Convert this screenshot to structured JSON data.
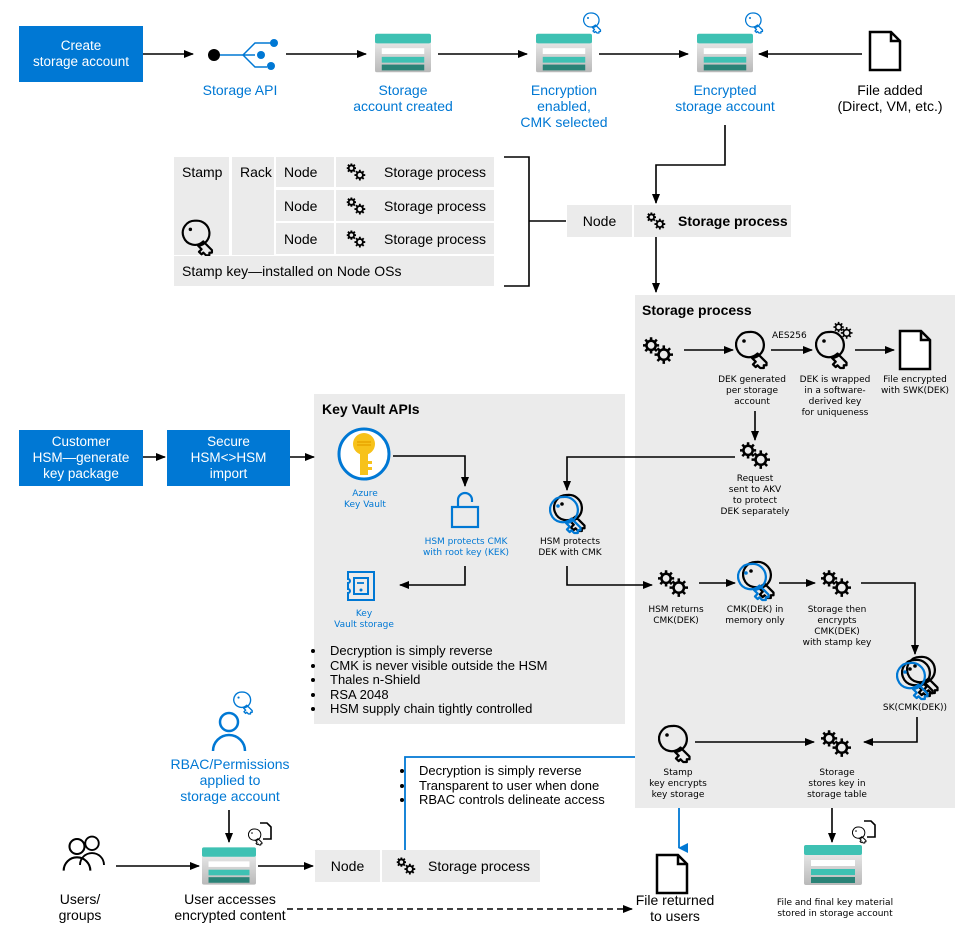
{
  "top_row": {
    "create_button": "Create\nstorage account",
    "storage_api": "Storage API",
    "account_created": "Storage\naccount created",
    "encryption_enabled": "Encryption\nenabled,\nCMK selected",
    "encrypted_account": "Encrypted\nstorage account",
    "file_added": "File added\n(Direct, VM, etc.)"
  },
  "stamp_table": {
    "stamp": "Stamp",
    "rack": "Rack",
    "rows": [
      {
        "node": "Node",
        "process": "Storage process"
      },
      {
        "node": "Node",
        "process": "Storage process"
      },
      {
        "node": "Node",
        "process": "Storage process"
      }
    ],
    "footer": "Stamp key—installed on Node OSs"
  },
  "node_bar": {
    "node": "Node",
    "process": "Storage process"
  },
  "storage_process_panel": {
    "title": "Storage process",
    "aes_label": "AES256",
    "dek_generated": "DEK generated\nper storage\naccount",
    "dek_wrapped": "DEK is wrapped\nin a software-\nderived key\nfor uniqueness",
    "file_encrypted": "File encrypted\nwith SWK(DEK)",
    "request_sent": "Request\nsent to AKV\nto protect\nDEK separately",
    "hsm_returns": "HSM returns\nCMK(DEK)",
    "cmk_in_memory": "CMK(DEK) in\nmemory only",
    "storage_encrypts": "Storage then\nencrypts\nCMK(DEK)\nwith stamp key",
    "sk_cmk_dek": "SK(CMK(DEK))",
    "stamp_key_encrypts": "Stamp\nkey encrypts\nkey storage",
    "storage_stores": "Storage\nstores key in\nstorage table"
  },
  "hsm_flow": {
    "customer_hsm": "Customer\nHSM—generate\nkey package",
    "secure_import": "Secure\nHSM<>HSM\nimport"
  },
  "key_vault_panel": {
    "title": "Key Vault APIs",
    "azure_key_vault": "Azure\nKey Vault",
    "hsm_protects_cmk": "HSM protects CMK\nwith root key (KEK)",
    "hsm_protects_dek": "HSM protects\nDEK with CMK",
    "key_vault_storage": "Key\nVault storage",
    "bullets": [
      "Decryption is simply reverse",
      "CMK is never visible outside the HSM",
      "Thales n-Shield",
      "RSA 2048",
      "HSM supply chain tightly controlled"
    ]
  },
  "bottom": {
    "rbac": "RBAC/Permissions\napplied to\nstorage account",
    "users_groups": "Users/\ngroups",
    "user_accesses": "User accesses\nencrypted content",
    "node": "Node",
    "process": "Storage process",
    "bullets": [
      "Decryption is simply reverse",
      "Transparent to user when done",
      "RBAC controls delineate access"
    ],
    "file_returned": "File returned\nto users",
    "final_storage": "File and final key material\nstored in storage account"
  },
  "colors": {
    "accent_blue": "#0078d4",
    "panel_gray": "#ebebeb",
    "storage_teal": "#3ec1b3",
    "storage_dark_teal": "#2a8377",
    "key_gold": "#f7c21a"
  }
}
